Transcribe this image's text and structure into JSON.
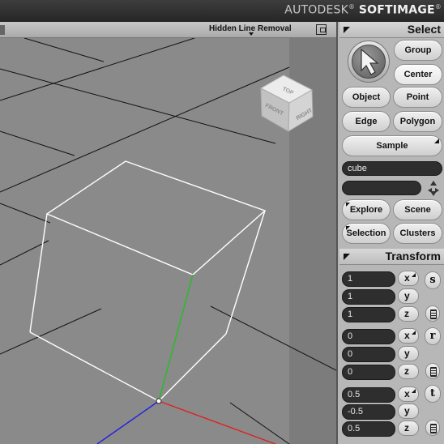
{
  "app": {
    "brand_prefix": "AUTODESK",
    "brand_reg": "®",
    "brand_name": "SOFTIMAGE",
    "brand_reg2": "®"
  },
  "viewport": {
    "display_mode": "Hidden Line Removal",
    "nav_cube": {
      "top": "TOP",
      "front": "FRONT",
      "right": "RIGHT"
    }
  },
  "select_panel": {
    "title": "Select",
    "buttons": {
      "group": "Group",
      "center": "Center",
      "object": "Object",
      "point": "Point",
      "edge": "Edge",
      "polygon": "Polygon",
      "sample": "Sample"
    },
    "name_field": "cube",
    "secondary_field": "",
    "explore": "Explore",
    "scene": "Scene",
    "selection": "Selection",
    "clusters": "Clusters"
  },
  "transform_panel": {
    "title": "Transform",
    "scale": {
      "mode": "s",
      "x": "1",
      "y": "1",
      "z": "1"
    },
    "rotate": {
      "mode": "r",
      "x": "0",
      "y": "0",
      "z": "0"
    },
    "translate": {
      "mode": "t",
      "x": "0.5",
      "y": "-0.5",
      "z": "0.5"
    },
    "axis_labels": {
      "x": "x",
      "y": "y",
      "z": "z"
    }
  },
  "colors": {
    "viewport_bg": "#8a8a8a",
    "grid_line": "#111111",
    "cube_edge": "#ffffff",
    "axis_x": "#e02020",
    "axis_y": "#20c020",
    "axis_z": "#2020e0",
    "panel_bg": "#b7b7b7"
  }
}
